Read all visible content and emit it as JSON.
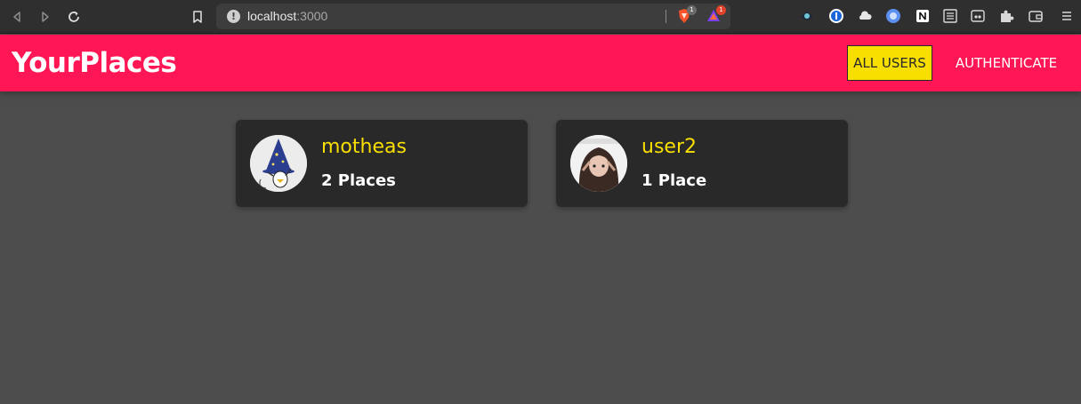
{
  "browser": {
    "url_host": "localhost",
    "url_port": ":3000",
    "brave_badge": "1",
    "rewards_badge": "1"
  },
  "header": {
    "title": "YourPlaces",
    "nav": [
      {
        "label": "ALL USERS",
        "active": true
      },
      {
        "label": "AUTHENTICATE",
        "active": false
      }
    ]
  },
  "users": [
    {
      "name": "motheas",
      "places": "2 Places",
      "avatar_icon": "wizard-avatar"
    },
    {
      "name": "user2",
      "places": "1 Place",
      "avatar_icon": "anime-girl-avatar"
    }
  ],
  "colors": {
    "header_bg": "#ff1654",
    "accent_yellow": "#f8df00",
    "page_bg": "#4d4d4d",
    "card_bg": "#292929"
  }
}
